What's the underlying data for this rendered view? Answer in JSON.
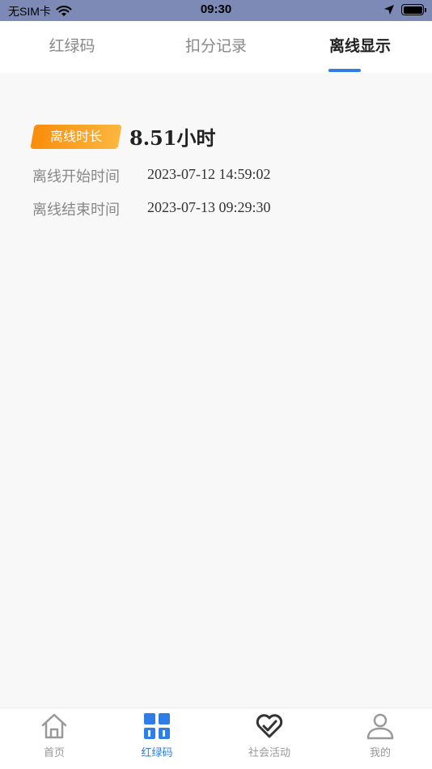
{
  "status_bar": {
    "carrier": "无SIM卡",
    "time": "09:30"
  },
  "tabs": [
    {
      "label": "红绿码",
      "active": false
    },
    {
      "label": "扣分记录",
      "active": false
    },
    {
      "label": "离线显示",
      "active": true
    }
  ],
  "offline": {
    "badge_label": "离线时长",
    "duration": "8.51小时",
    "start_label": "离线开始时间",
    "start_value": "2023-07-12 14:59:02",
    "end_label": "离线结束时间",
    "end_value": "2023-07-13 09:29:30"
  },
  "bottom_nav": [
    {
      "label": "首页",
      "icon": "home-icon",
      "active": false
    },
    {
      "label": "红绿码",
      "icon": "grid-icon",
      "active": true
    },
    {
      "label": "社会活动",
      "icon": "heart-check-icon",
      "active": false
    },
    {
      "label": "我的",
      "icon": "user-icon",
      "active": false
    }
  ],
  "colors": {
    "accent": "#2f7ee8",
    "badge_start": "#f98d0a",
    "badge_end": "#fcb63f",
    "status_bar": "#7d8ab5"
  }
}
